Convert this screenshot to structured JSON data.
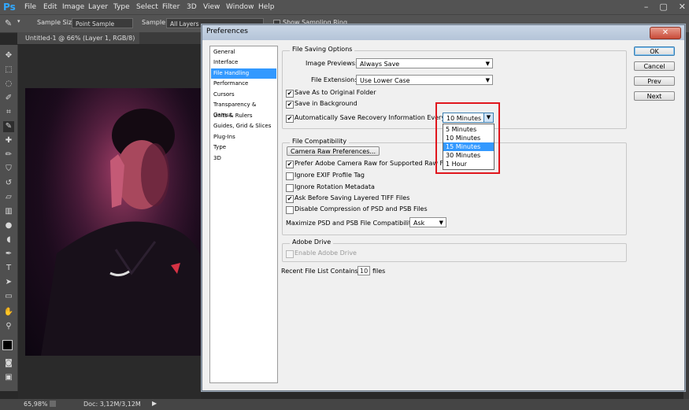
{
  "app": {
    "logo": "Ps",
    "menu": [
      "File",
      "Edit",
      "Image",
      "Layer",
      "Type",
      "Select",
      "Filter",
      "3D",
      "View",
      "Window",
      "Help"
    ],
    "window_controls": [
      "–",
      "▢",
      "✕"
    ]
  },
  "options_bar": {
    "sample_size_label": "Sample Size:",
    "sample_size_value": "Point Sample",
    "sample_label": "Sample:",
    "sample_value": "All Layers",
    "show_ring_label": "Show Sampling Ring"
  },
  "document": {
    "tab_label": "Untitled-1 @ 66% (Layer 1, RGB/8) *"
  },
  "statusbar": {
    "zoom": "65,98%",
    "doc_info": "Doc: 3,12M/3,12M"
  },
  "dialog": {
    "title": "Preferences",
    "categories": [
      "General",
      "Interface",
      "File Handling",
      "Performance",
      "Cursors",
      "Transparency & Gamut",
      "Units & Rulers",
      "Guides, Grid & Slices",
      "Plug-Ins",
      "Type",
      "3D"
    ],
    "selected_category": "File Handling",
    "buttons": {
      "ok": "OK",
      "cancel": "Cancel",
      "prev": "Prev",
      "next": "Next"
    },
    "file_saving": {
      "title": "File Saving Options",
      "image_previews_label": "Image Previews:",
      "image_previews_value": "Always Save",
      "file_extension_label": "File Extension:",
      "file_extension_value": "Use Lower Case",
      "save_as_original": "Save As to Original Folder",
      "save_in_background": "Save in Background",
      "auto_save_label": "Automatically Save Recovery Information Every:",
      "auto_save_value": "10 Minutes",
      "auto_save_options": [
        "5 Minutes",
        "10 Minutes",
        "15 Minutes",
        "30 Minutes",
        "1 Hour"
      ],
      "auto_save_highlighted": "15 Minutes"
    },
    "file_compat": {
      "title": "File Compatibility",
      "camera_raw_button": "Camera Raw Preferences...",
      "prefer_camera_raw": "Prefer Adobe Camera Raw for Supported Raw Files",
      "ignore_exif": "Ignore EXIF Profile Tag",
      "ignore_rotation": "Ignore Rotation Metadata",
      "ask_tiff": "Ask Before Saving Layered TIFF Files",
      "disable_compression": "Disable Compression of PSD and PSB Files",
      "maximize_label": "Maximize PSD and PSB File Compatibility:",
      "maximize_value": "Ask"
    },
    "adobe_drive": {
      "title": "Adobe Drive",
      "enable": "Enable Adobe Drive"
    },
    "recent_files": {
      "label": "Recent File List Contains:",
      "value": "10",
      "suffix": "files"
    }
  },
  "colors": {
    "selection": "#3399ff",
    "highlight_box": "#e0161d"
  }
}
